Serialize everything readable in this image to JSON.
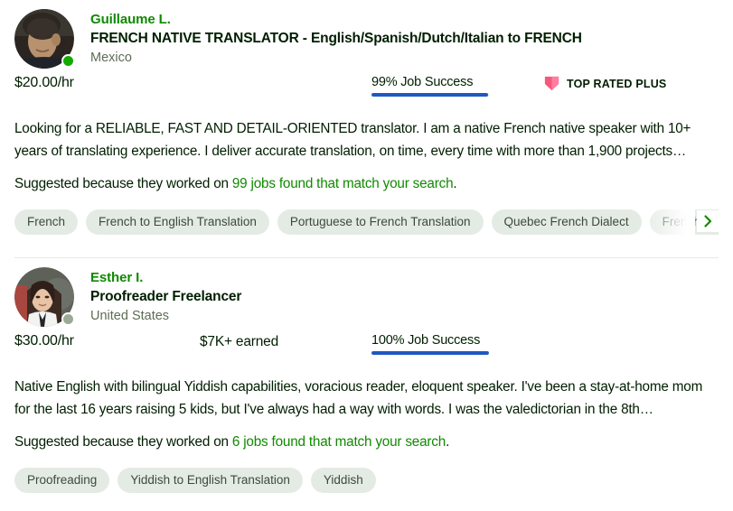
{
  "colors": {
    "link_green": "#108a00",
    "jss_bar_blue": "#1f57c3",
    "tag_bg": "#e4ebe4",
    "badge_pink": "#f5587b",
    "status_online": "#14a800",
    "status_offline": "#9aaa97",
    "text_primary": "#001e00",
    "text_muted": "#5e6d55",
    "divider": "#e4ebe4"
  },
  "freelancers": [
    {
      "name": "Guillaume L.",
      "title": "FRENCH NATIVE TRANSLATOR - English/Spanish/Dutch/Italian to FRENCH",
      "location": "Mexico",
      "avatar_alt": "guillaume-avatar",
      "online_status": "online",
      "rate": "$20.00/hr",
      "earned": "",
      "has_earned": false,
      "job_success": "99% Job Success",
      "job_success_pct": 99,
      "badge": {
        "label": "TOP RATED PLUS",
        "icon": "shield-icon",
        "visible": true
      },
      "description": "Looking for a RELIABLE, FAST AND DETAIL-ORIENTED translator. I am a native French native speaker with 10+ years of translating experience. I deliver accurate translation, on time, every time with more than 1,900 projects…",
      "suggested_prefix": "Suggested because they worked on ",
      "suggested_link": "99 jobs found that match your search",
      "suggested_suffix": ".",
      "tags": [
        "French",
        "French to English Translation",
        "Portuguese to French Translation",
        "Quebec French Dialect",
        "French to Spanish Translation"
      ],
      "has_tag_overflow": true,
      "next_icon": "chevron-right-icon"
    },
    {
      "name": "Esther I.",
      "title": "Proofreader Freelancer",
      "location": "United States",
      "avatar_alt": "esther-avatar",
      "online_status": "offline",
      "rate": "$30.00/hr",
      "earned": "$7K+ earned",
      "has_earned": true,
      "job_success": "100% Job Success",
      "job_success_pct": 100,
      "badge": {
        "label": "",
        "icon": "",
        "visible": false
      },
      "description": "Native English with bilingual Yiddish capabilities, voracious reader, eloquent speaker. I've been a stay-at-home mom for the last 16 years raising 5 kids, but I've always had a way with words. I was the valedictorian in the 8th…",
      "suggested_prefix": "Suggested because they worked on ",
      "suggested_link": "6 jobs found that match your search",
      "suggested_suffix": ".",
      "tags": [
        "Proofreading",
        "Yiddish to English Translation",
        "Yiddish"
      ],
      "has_tag_overflow": false,
      "next_icon": ""
    }
  ]
}
